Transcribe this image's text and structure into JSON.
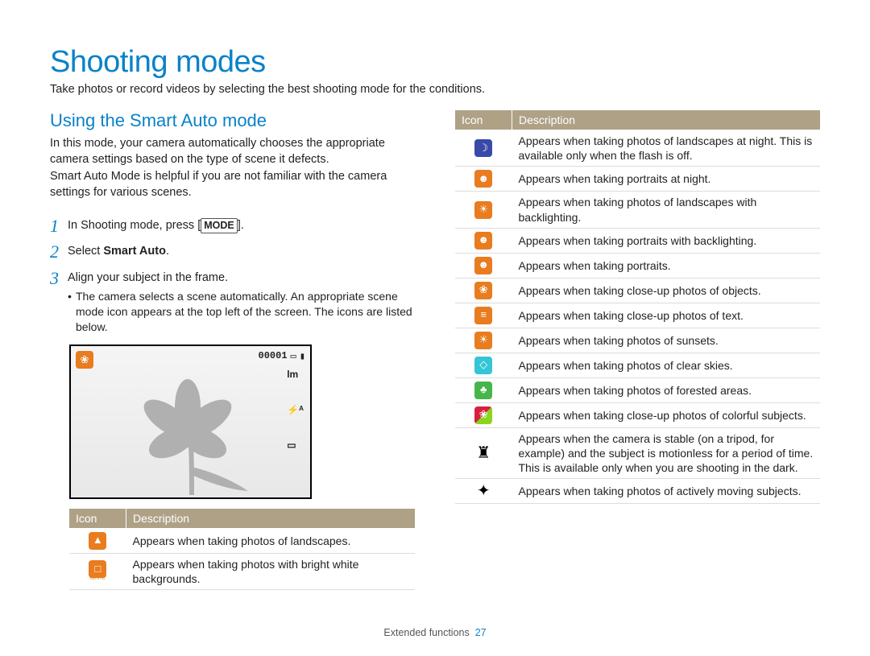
{
  "title": "Shooting modes",
  "subtitle": "Take photos or record videos by selecting the best shooting mode for the conditions.",
  "section": "Using the Smart Auto mode",
  "intro": {
    "p1": "In this mode, your camera automatically chooses the appropriate camera settings based on the type of scene it defects.",
    "p2": "Smart Auto Mode is helpful if you are not familiar with the camera settings for various scenes."
  },
  "steps": {
    "s1": {
      "n": "1",
      "a": "In Shooting mode, press [",
      "key": "MODE",
      "b": "]."
    },
    "s2": {
      "n": "2",
      "a": "Select ",
      "bold": "Smart Auto",
      "b": "."
    },
    "s3": {
      "n": "3",
      "text": "Align your subject in the frame.",
      "bullet": "The camera selects a scene automatically. An appropriate scene mode icon appears at the top left of the screen. The icons are listed below."
    }
  },
  "lcd": {
    "counter": "00001",
    "tag1": "lm",
    "tag2": "⚡ᴬ"
  },
  "tableHeaders": {
    "icon": "Icon",
    "desc": "Description"
  },
  "leftTable": [
    {
      "sym": "▲",
      "bg": "#e87c1f",
      "desc": "Appears when taking photos of landscapes."
    },
    {
      "sym": "□",
      "bg": "#e87c1f",
      "label": "WHITE",
      "desc": "Appears when taking photos with bright white backgrounds."
    }
  ],
  "rightTable": [
    {
      "sym": "☽",
      "bg": "#3a4aa8",
      "desc": "Appears when taking photos of landscapes at night. This is available only when the flash is off."
    },
    {
      "sym": "☻",
      "bg": "#e87c1f",
      "desc": "Appears when taking portraits at night."
    },
    {
      "sym": "☀",
      "bg": "#e87c1f",
      "desc": "Appears when taking photos of landscapes with backlighting."
    },
    {
      "sym": "☻",
      "bg": "#e87c1f",
      "desc": "Appears when taking portraits with backlighting."
    },
    {
      "sym": "☻",
      "bg": "#e87c1f",
      "desc": "Appears when taking portraits."
    },
    {
      "sym": "❀",
      "bg": "#e87c1f",
      "desc": "Appears when taking close-up photos of objects."
    },
    {
      "sym": "≡",
      "bg": "#e87c1f",
      "desc": "Appears when taking close-up photos of text."
    },
    {
      "sym": "☀",
      "bg": "#e87c1f",
      "desc": "Appears when taking photos of sunsets."
    },
    {
      "sym": "◇",
      "bg": "#33c6d6",
      "desc": "Appears when taking photos of clear skies."
    },
    {
      "sym": "♣",
      "bg": "#46b54a",
      "desc": "Appears when taking photos of forested areas."
    },
    {
      "sym": "❀",
      "bg": "#d6203d",
      "bg2": "linear-gradient(135deg,#d6203d 50%,#8bd41f 50%)",
      "desc": "Appears when taking close-up photos of colorful subjects."
    },
    {
      "sym": "♜",
      "fg": "#000",
      "bg": "transparent",
      "desc": "Appears when the camera is stable (on a tripod, for example) and the subject is motionless for a period of time. This is available only when you are shooting in the dark."
    },
    {
      "sym": "✦",
      "fg": "#000",
      "bg": "transparent",
      "desc": "Appears when taking photos of actively moving subjects."
    }
  ],
  "footer": {
    "label": "Extended functions",
    "page": "27"
  }
}
